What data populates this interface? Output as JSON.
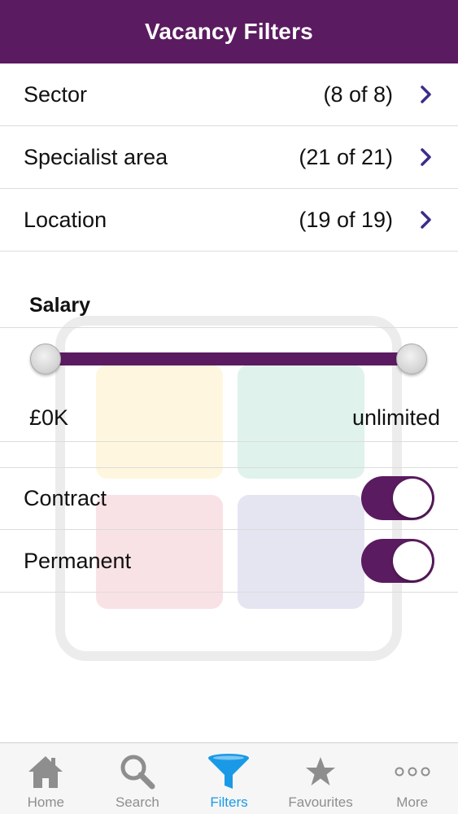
{
  "header": {
    "title": "Vacancy Filters"
  },
  "filters": [
    {
      "label": "Sector",
      "count": "(8 of 8)"
    },
    {
      "label": "Specialist area",
      "count": "(21 of 21)"
    },
    {
      "label": "Location",
      "count": "(19 of 19)"
    }
  ],
  "salary": {
    "title": "Salary",
    "min_label": "£0K",
    "max_label": "unlimited",
    "range_min_fraction": 0,
    "range_max_fraction": 1
  },
  "toggles": [
    {
      "label": "Contract",
      "on": true
    },
    {
      "label": "Permanent",
      "on": true
    }
  ],
  "tabbar": {
    "active": "Filters",
    "tabs": [
      {
        "label": "Home",
        "icon": "home-icon"
      },
      {
        "label": "Search",
        "icon": "search-icon"
      },
      {
        "label": "Filters",
        "icon": "filter-icon"
      },
      {
        "label": "Favourites",
        "icon": "star-icon"
      },
      {
        "label": "More",
        "icon": "more-icon"
      }
    ]
  },
  "colors": {
    "brand": "#5b1b60",
    "active_tab": "#1a9ae6",
    "inactive_tab": "#8e8e8e",
    "chevron": "#3b2d8a"
  }
}
